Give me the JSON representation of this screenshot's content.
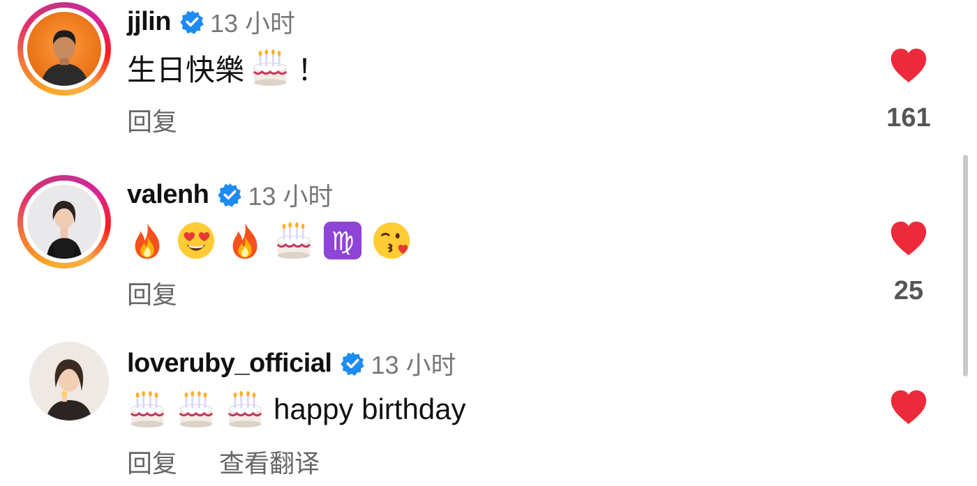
{
  "comments": [
    {
      "username": "jjlin",
      "verified": true,
      "time": "13 小时",
      "text_before": "生日快樂",
      "emojis": [
        "birthday-cake"
      ],
      "text_after": "！",
      "actions": [
        "回复"
      ],
      "liked": true,
      "like_count": "161"
    },
    {
      "username": "valenh",
      "verified": true,
      "time": "13 小时",
      "emojis": [
        "fire",
        "heart-eyes",
        "fire",
        "birthday-cake",
        "virgo",
        "kissing-heart"
      ],
      "actions": [
        "回复"
      ],
      "liked": true,
      "like_count": "25"
    },
    {
      "username": "loveruby_official",
      "verified": true,
      "time": "13 小时",
      "emojis": [
        "birthday-cake",
        "birthday-cake",
        "birthday-cake"
      ],
      "text_after": "happy birthday",
      "actions": [
        "回复",
        "查看翻译"
      ],
      "liked": true,
      "like_count": ""
    }
  ],
  "colors": {
    "heart": "#ed2a3b",
    "verified": "#1d8bf0",
    "secondary_text": "#777777"
  }
}
